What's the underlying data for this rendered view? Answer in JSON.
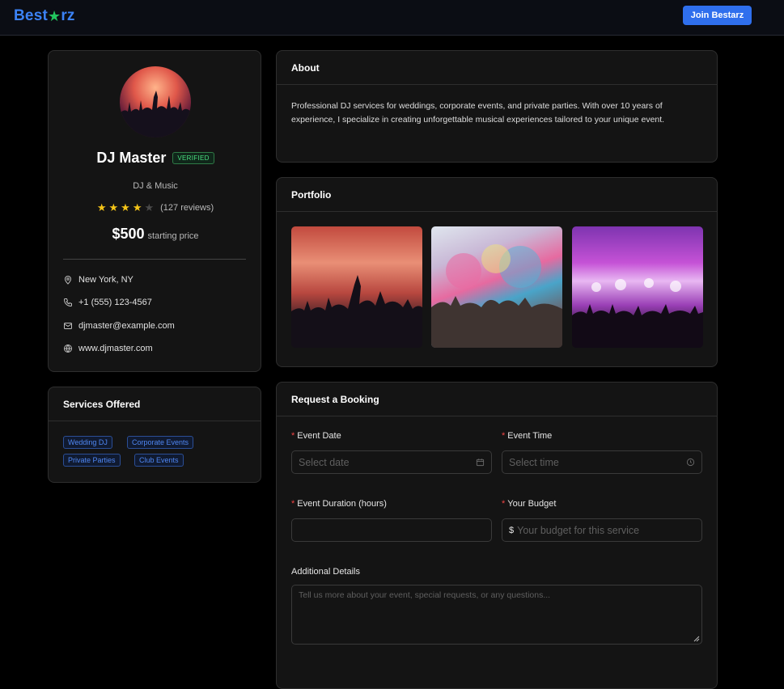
{
  "nav": {
    "logo_part1": "Best",
    "logo_star": "★",
    "logo_part2": "rz",
    "join_label": "Join Bestarz"
  },
  "profile": {
    "name": "DJ Master",
    "verified_badge": "VERIFIED",
    "category": "DJ & Music",
    "rating": 4,
    "rating_max": 5,
    "reviews": "(127 reviews)",
    "price": "$500",
    "price_label": "starting price",
    "contacts": {
      "location": "New York, NY",
      "phone": "+1 (555) 123-4567",
      "email": "djmaster@example.com",
      "website": "www.djmaster.com"
    }
  },
  "services": {
    "title": "Services Offered",
    "tags": [
      "Wedding DJ",
      "Corporate Events",
      "Private Parties",
      "Club Events"
    ]
  },
  "about": {
    "title": "About",
    "text": "Professional DJ services for weddings, corporate events, and private parties. With over 10 years of experience, I specialize in creating unforgettable musical experiences tailored to your unique event."
  },
  "portfolio": {
    "title": "Portfolio"
  },
  "booking": {
    "title": "Request a Booking",
    "event_date_label": "Event Date",
    "event_date_placeholder": "Select date",
    "event_time_label": "Event Time",
    "event_time_placeholder": "Select time",
    "duration_label": "Event Duration (hours)",
    "duration_value": "",
    "budget_label": "Your Budget",
    "budget_prefix": "$",
    "budget_placeholder": "Your budget for this service",
    "details_label": "Additional Details",
    "details_placeholder": "Tell us more about your event, special requests, or any questions..."
  },
  "colors": {
    "accent": "#2f6fed",
    "logo_blue": "#3b82f6",
    "logo_star": "#22c55e",
    "star": "#f5c518",
    "verified": "#4ade80",
    "required": "#ef4444"
  }
}
